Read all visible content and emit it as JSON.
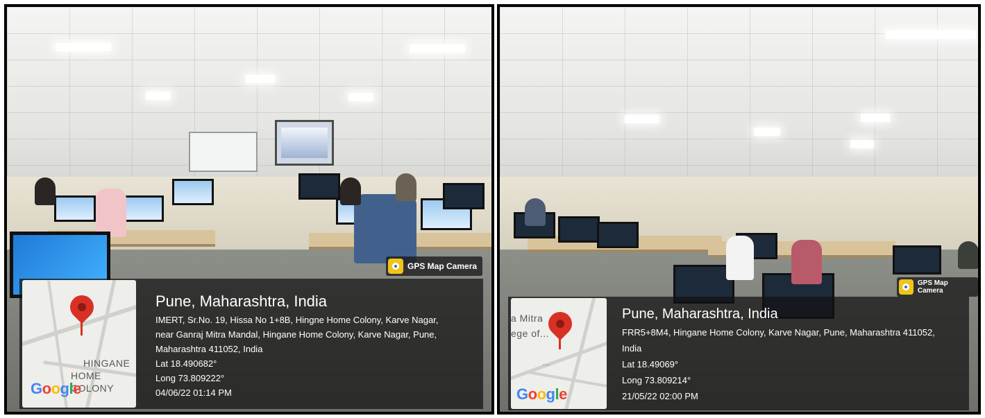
{
  "colors": {
    "card_bg": "#121212",
    "pin": "#d93025",
    "google_blue": "#4285f4",
    "google_red": "#ea4335",
    "google_yellow": "#fbbc05",
    "google_green": "#34a853"
  },
  "left": {
    "badge": {
      "icon": "gps-map-camera-icon",
      "label": "GPS Map Camera"
    },
    "map": {
      "label_line1": "HINGANE",
      "label_line2": "HOME COLONY",
      "pin_icon": "map-pin-icon"
    },
    "google": [
      "G",
      "o",
      "o",
      "g",
      "l",
      "e"
    ],
    "city": "Pune, Maharashtra, India",
    "address_line1": "IMERT, Sr.No. 19, Hissa No 1+8B, Hingne Home Colony, Karve Nagar,",
    "address_line2": "near Ganraj Mitra Mandal, Hingane Home Colony, Karve Nagar, Pune,",
    "address_line3": "Maharashtra 411052, India",
    "lat": "Lat 18.490682°",
    "long": "Long 73.809222°",
    "datetime": "04/06/22 01:14 PM"
  },
  "right": {
    "badge": {
      "icon": "gps-map-camera-icon",
      "label": "GPS Map Camera"
    },
    "map": {
      "label_line1": "a Mitra",
      "label_line2": "ege of...",
      "label_line3": "...",
      "pin_icon": "map-pin-icon"
    },
    "google": [
      "G",
      "o",
      "o",
      "g",
      "l",
      "e"
    ],
    "city": "Pune, Maharashtra, India",
    "address_line1": "FRR5+8M4, Hingane Home Colony, Karve Nagar, Pune, Maharashtra 411052,",
    "address_line2": "India",
    "lat": "Lat 18.49069°",
    "long": "Long 73.809214°",
    "datetime": "21/05/22 02:00 PM"
  }
}
